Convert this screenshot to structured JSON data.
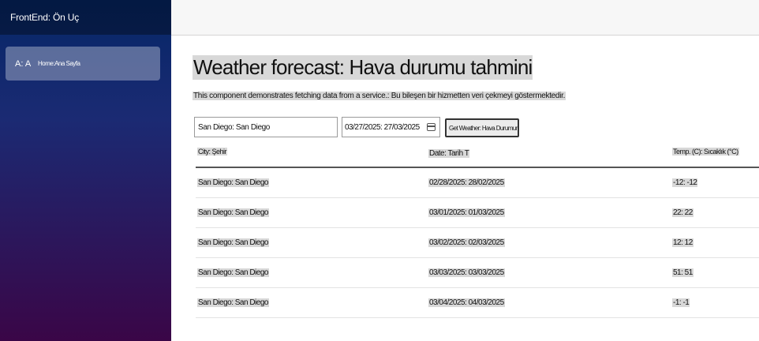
{
  "sidebar": {
    "brand": "FrontEnd: Ön Uç",
    "items": [
      {
        "icon": "A: A",
        "label": "Home:Ana Sayfa",
        "active": true
      }
    ]
  },
  "page": {
    "title": "Weather forecast: Hava durumu tahmini",
    "description": "This component demonstrates fetching data from a service.: Bu bileşen bir hizmetten veri çekmeyi göstermektedir."
  },
  "form": {
    "city_value": "San Diego: San Diego",
    "date_value": "03/27/2025: 27/03/2025",
    "button_label": "Get Weather: Hava Durumunu Al"
  },
  "table": {
    "headers": [
      "City: Şehir",
      "Date: Tarih T",
      "Temp. (C): Sıcaklık (°C)"
    ],
    "rows": [
      [
        "San Diego: San Diego",
        "02/28/2025: 28/02/2025",
        "-12: -12"
      ],
      [
        "San Diego: San Diego",
        "03/01/2025: 01/03/2025",
        "22: 22"
      ],
      [
        "San Diego: San Diego",
        "03/02/2025: 02/03/2025",
        "12: 12"
      ],
      [
        "San Diego: San Diego",
        "03/03/2025: 03/03/2025",
        "51: 51"
      ],
      [
        "San Diego: San Diego",
        "03/04/2025: 04/03/2025",
        "-1: -1"
      ]
    ]
  },
  "colors": {
    "sidebar_top": "#052767",
    "sidebar_bottom": "#3a0647",
    "top_row": "#f7f7f7"
  }
}
